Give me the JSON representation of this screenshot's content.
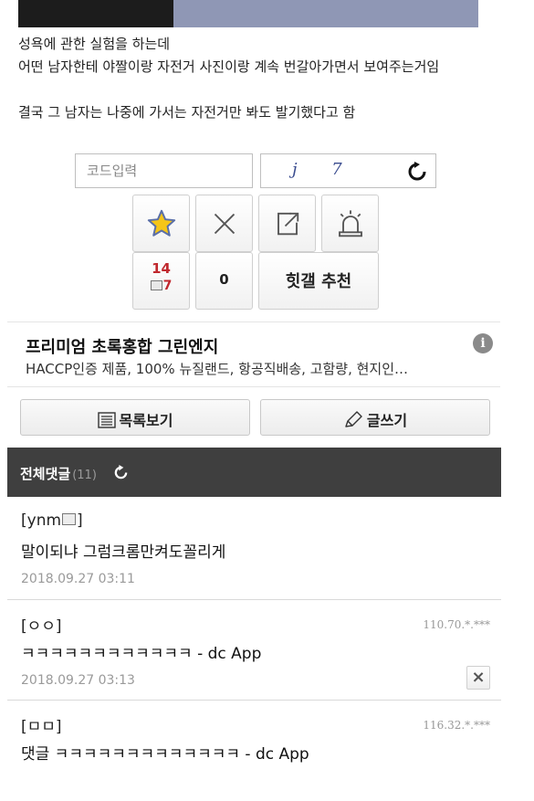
{
  "post": {
    "lines": [
      "성욕에 관한 실험을 하는데",
      "어떤 남자한테 야짤이랑 자전거 사진이랑 계속 번갈아가면서 보여주는거임",
      "결국 그 남자는 나중에 가서는 자전거만 봐도 발기했다고 함"
    ]
  },
  "captcha": {
    "placeholder": "코드입력",
    "code": "j 7"
  },
  "actions": {
    "recommend_count": "14",
    "fix_recommend_count": "7",
    "dislike_count": "0",
    "recommend_label": "힛갤 추천"
  },
  "ad": {
    "title": "프리미엄 초록홍합 그린엔지",
    "description": "HACCP인증 제품, 100% 뉴질랜드, 항공직배송, 고함량, 현지인…",
    "info_icon": "i"
  },
  "buttons": {
    "list_label": "목록보기",
    "write_label": "글쓰기"
  },
  "comments_header": {
    "title": "전체댓글",
    "count": "(11)"
  },
  "comments": [
    {
      "nick_open": "[ynm",
      "nick_close": "]",
      "ip": "",
      "body": "말이되냐 그럼크롬만켜도꼴리게",
      "date": "2018.09.27 03:11"
    },
    {
      "nick": "[ㅇㅇ]",
      "ip": "110.70.*.***",
      "body": "ㅋㅋㅋㅋㅋㅋㅋㅋㅋㅋㅋㅋ - dc App",
      "date": "2018.09.27 03:13",
      "delete": "×"
    },
    {
      "nick": "[ㅁㅁ]",
      "ip": "116.32.*.***",
      "body": "댓글 ㅋㅋㅋㅋㅋㅋㅋㅋㅋㅋㅋㅋㅋ - dc App"
    }
  ],
  "colors": {
    "header_bg": "#3f3f3f",
    "recommend_red": "#c0282e",
    "star_fill": "#f5c518"
  }
}
